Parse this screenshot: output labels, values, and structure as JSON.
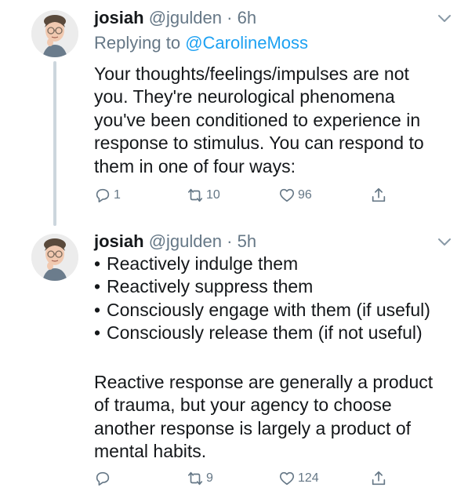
{
  "tweets": [
    {
      "name": "josiah",
      "handle": "@jgulden",
      "separator": "·",
      "time": "6h",
      "reply_prefix": "Replying to ",
      "reply_to": "@CarolineMoss",
      "text": "Your thoughts/feelings/impulses are not\nyou. They're neurological phenomena\nyou've been conditioned to experience in\nresponse to stimulus. You can respond to\nthem in one of four ways:",
      "replies": "1",
      "retweets": "10",
      "likes": "96"
    },
    {
      "name": "josiah",
      "handle": "@jgulden",
      "separator": "·",
      "time": "5h",
      "bullet_char": "•",
      "bullets": [
        "Reactively indulge them",
        "Reactively suppress them",
        "Consciously engage with them (if useful)",
        "Consciously release them (if not useful)"
      ],
      "text": "Reactive response are generally a product\nof trauma, but your agency to choose\nanother response is largely a product of\nmental habits.",
      "retweets": "9",
      "likes": "124"
    }
  ],
  "icons": {
    "avatar": "memoji-avatar",
    "menu": "chevron-down-icon",
    "reply": "reply-icon",
    "retweet": "retweet-icon",
    "like": "heart-icon",
    "share": "share-icon"
  },
  "colors": {
    "text": "#14171a",
    "secondary": "#657786",
    "link": "#1da1f2",
    "thread_line": "#ccd6dd"
  }
}
